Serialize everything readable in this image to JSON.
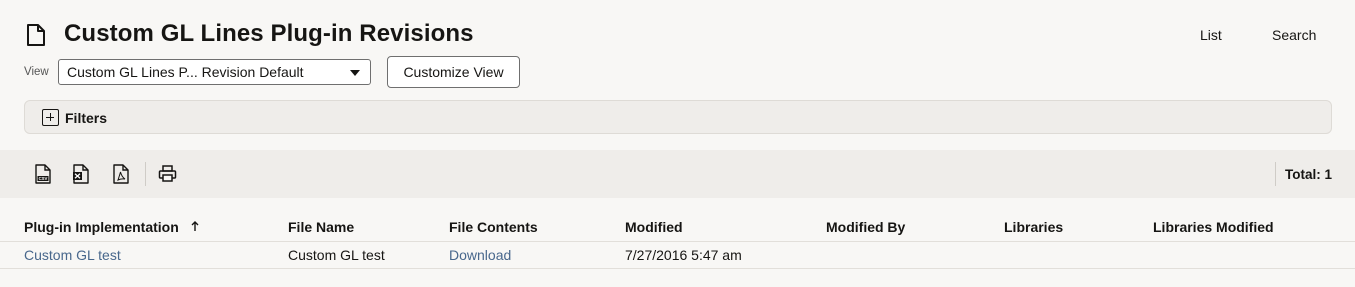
{
  "header": {
    "title": "Custom GL Lines Plug-in Revisions",
    "links": {
      "list": "List",
      "search": "Search"
    }
  },
  "view": {
    "label": "View",
    "selected": "Custom GL Lines P... Revision Default",
    "customize_label": "Customize View"
  },
  "filters": {
    "label": "Filters"
  },
  "toolbar": {
    "icons": [
      "csv-export-icon",
      "excel-export-icon",
      "pdf-export-icon",
      "print-icon"
    ],
    "total": "Total: 1"
  },
  "table": {
    "columns": [
      "Plug-in Implementation",
      "File Name",
      "File Contents",
      "Modified",
      "Modified By",
      "Libraries",
      "Libraries Modified"
    ],
    "sort_column": "Plug-in Implementation",
    "sort_direction": "ascending",
    "rows": [
      {
        "implementation": "Custom GL test",
        "file_name": "Custom GL test",
        "file_contents": "Download",
        "modified": "7/27/2016 5:47 am",
        "modified_by": "",
        "libraries": "",
        "libraries_modified": ""
      }
    ]
  },
  "colors": {
    "link": "#48678c",
    "text": "#161513",
    "background": "#f8f7f5",
    "bar": "#efedea"
  }
}
